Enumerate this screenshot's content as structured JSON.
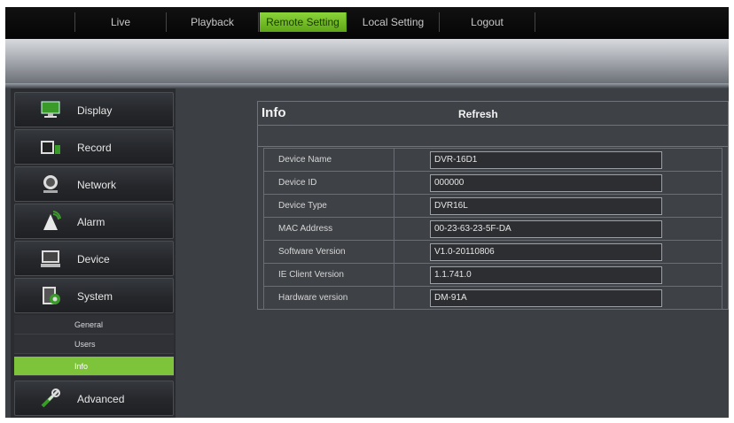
{
  "nav": {
    "tabs": [
      {
        "label": "Live"
      },
      {
        "label": "Playback"
      },
      {
        "label": "Remote Setting"
      },
      {
        "label": "Local Setting"
      },
      {
        "label": "Logout"
      }
    ],
    "active_tab": "Remote Setting"
  },
  "sidebar": {
    "items": [
      {
        "label": "Display",
        "icon": "monitor-icon"
      },
      {
        "label": "Record",
        "icon": "record-icon"
      },
      {
        "label": "Network",
        "icon": "network-icon"
      },
      {
        "label": "Alarm",
        "icon": "alarm-icon"
      },
      {
        "label": "Device",
        "icon": "device-icon"
      },
      {
        "label": "System",
        "icon": "system-icon"
      }
    ],
    "system_subitems": [
      {
        "label": "General"
      },
      {
        "label": "Users"
      },
      {
        "label": "Info"
      }
    ],
    "active_subitem": "Info",
    "advanced": {
      "label": "Advanced",
      "icon": "tools-icon"
    }
  },
  "panel": {
    "title": "Info",
    "refresh_label": "Refresh",
    "rows": [
      {
        "key": "Device Name",
        "value": "DVR-16D1"
      },
      {
        "key": "Device ID",
        "value": "000000"
      },
      {
        "key": "Device Type",
        "value": "DVR16L"
      },
      {
        "key": "MAC Address",
        "value": "00-23-63-23-5F-DA"
      },
      {
        "key": "Software Version",
        "value": "V1.0-20110806"
      },
      {
        "key": "IE Client Version",
        "value": "1.1.741.0"
      },
      {
        "key": "Hardware version",
        "value": "DM-91A"
      }
    ]
  },
  "colors": {
    "accent_green": "#7ec43a",
    "background_dark": "#3c3f44"
  }
}
